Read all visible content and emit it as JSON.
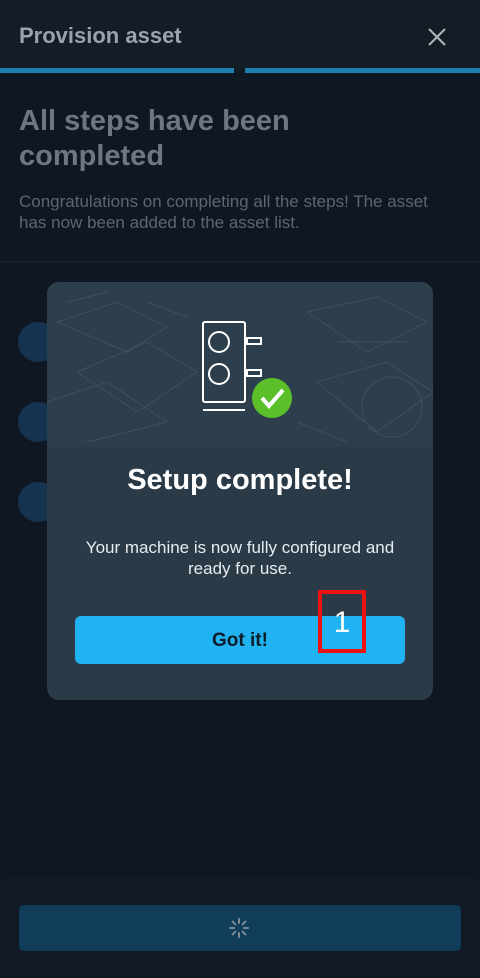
{
  "header": {
    "title": "Provision asset",
    "close_icon": "close-icon"
  },
  "progress": {
    "steps_total": 2,
    "steps_completed": 2
  },
  "page": {
    "heading": "All steps have been completed",
    "description": "Congratulations on completing all the steps! The asset has now been added to the asset list."
  },
  "modal": {
    "illustration": "machine-check-icon",
    "title": "Setup complete!",
    "text": "Your machine is now fully configured and ready for use.",
    "button_label": "Got it!"
  },
  "annotation": {
    "label": "1",
    "color": "#ee1111"
  },
  "footer": {
    "button_state": "loading",
    "spinner_icon": "spinner-icon"
  },
  "colors": {
    "accent": "#20b2f1",
    "success": "#5bbf2a",
    "modal_bg": "#2a3a47"
  }
}
